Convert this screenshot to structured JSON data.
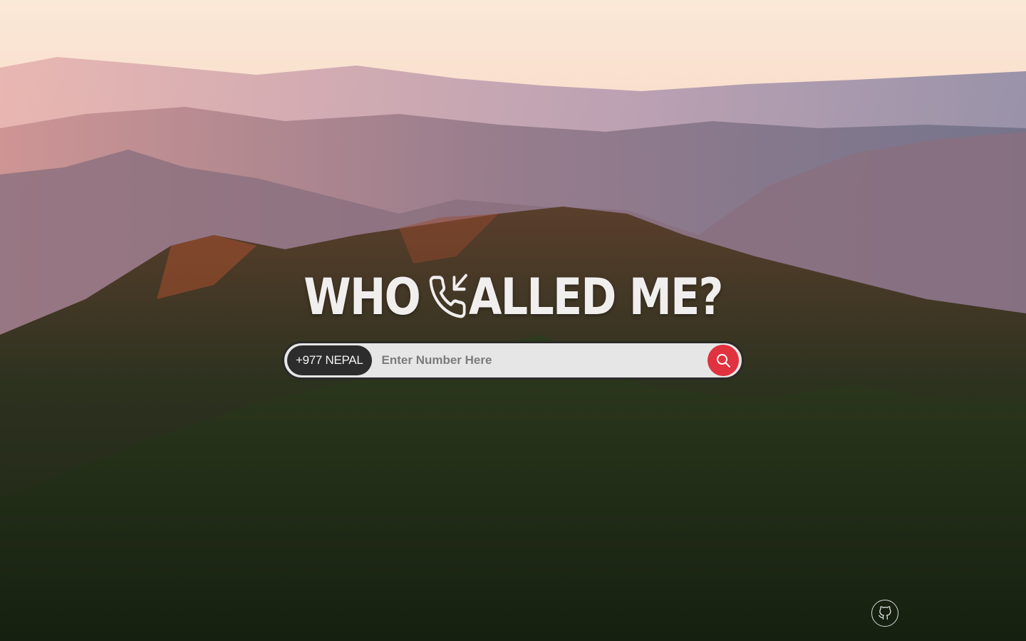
{
  "title": {
    "word_before_icon": "WHO",
    "icon": "phone-incoming-icon",
    "word_after_icon": "ALLED ME?"
  },
  "search": {
    "country_code_label": "+977 NEPAL",
    "placeholder": "Enter Number Here",
    "value": "",
    "submit_icon": "search-icon"
  },
  "footer": {
    "github_icon": "github-icon"
  },
  "colors": {
    "title_text": "#f1eeee",
    "search_bar_bg": "#e6e6e6",
    "country_pill_bg": "#2c2c2c",
    "search_button_bg": "#e0323f"
  }
}
